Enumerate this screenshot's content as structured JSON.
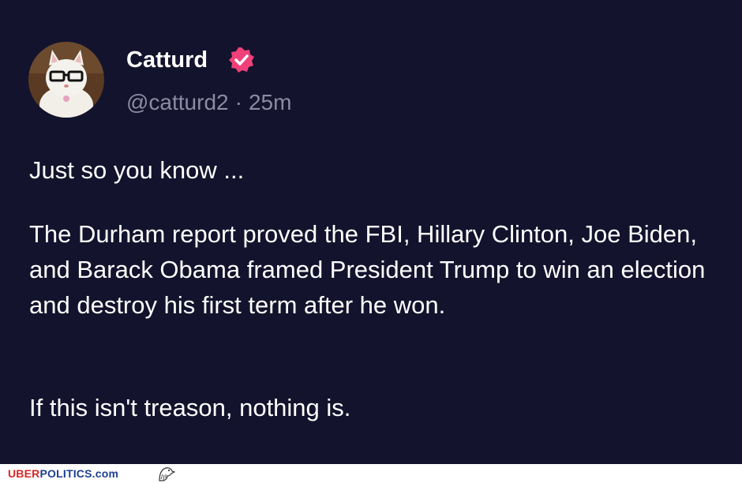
{
  "post": {
    "author_name": "Catturd",
    "handle": "@catturd2",
    "separator": "·",
    "time_ago": "25m",
    "verified_badge_icon": "verified-badge-icon",
    "verified_color": "#f0407a",
    "paragraphs": [
      "Just so you know ...",
      "The Durham report proved the FBI, Hillary Clinton, Joe Biden, and Barack Obama framed President Trump to win an election and destroy his first term after he won.",
      "If this isn't treason, nothing is."
    ]
  },
  "footer": {
    "brand_uber": "UBER",
    "brand_politics": "POLITICS.com",
    "eagle_icon": "eagle-icon",
    "brand_red": "#d62828",
    "brand_blue": "#1c3f8f"
  },
  "theme": {
    "background": "#14132d",
    "text": "#ffffff",
    "muted": "#8c8ba3"
  }
}
